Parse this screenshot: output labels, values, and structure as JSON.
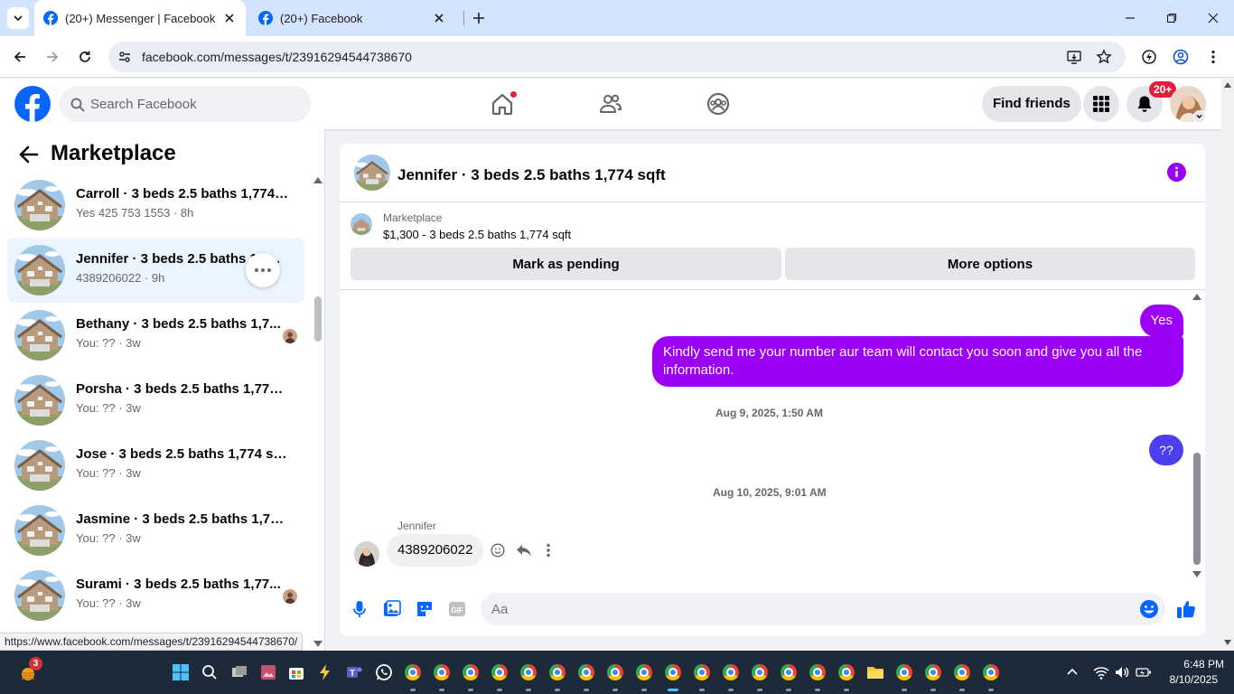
{
  "browser": {
    "tabs": [
      {
        "title": "(20+) Messenger | Facebook",
        "active": true
      },
      {
        "title": "(20+) Facebook",
        "active": false
      }
    ],
    "url": "facebook.com/messages/t/23916294544738670",
    "status_url": "https://www.facebook.com/messages/t/23916294544738670/"
  },
  "fb_header": {
    "search_placeholder": "Search Facebook",
    "find_friends": "Find friends",
    "notif_badge": "20+",
    "brand_color": "#0866ff"
  },
  "sidebar": {
    "title": "Marketplace",
    "conversations": [
      {
        "name": "Carroll · 3 beds 2.5 baths 1,774 s...",
        "sub": "Yes 425 753 1553 · 8h",
        "selected": false
      },
      {
        "name": "Jennifer · 3 beds 2.5 baths 1,7...",
        "sub": "4389206022 · 9h",
        "selected": true
      },
      {
        "name": "Bethany · 3 beds 2.5 baths 1,7...",
        "sub": "You: ?? · 3w",
        "selected": false
      },
      {
        "name": "Porsha · 3 beds 2.5 baths 1,774 s...",
        "sub": "You: ?? · 3w",
        "selected": false
      },
      {
        "name": "Jose · 3 beds 2.5 baths 1,774 sqft",
        "sub": "You: ?? · 3w",
        "selected": false
      },
      {
        "name": "Jasmine · 3 beds 2.5 baths 1,774 ...",
        "sub": "You: ?? · 3w",
        "selected": false
      },
      {
        "name": "Surami · 3 beds 2.5 baths 1,77...",
        "sub": "You: ?? · 3w",
        "selected": false
      }
    ]
  },
  "chat": {
    "title": "Jennifer · 3 beds 2.5 baths 1,774 sqft",
    "listing_label": "Marketplace",
    "listing_desc": "$1,300 - 3 beds 2.5 baths 1,774 sqft",
    "mark_pending": "Mark as pending",
    "more_options": "More options",
    "messages": {
      "out1": "Yes",
      "out2": "Kindly send me your number aur team will contact you soon and give you all the information.",
      "time1": "Aug 9, 2025, 1:50 AM",
      "out3": "??",
      "time2": "Aug 10, 2025, 9:01 AM",
      "sender": "Jennifer",
      "in1": "4389206022"
    },
    "composer_placeholder": "Aa",
    "accent_color": "#9b00f5"
  },
  "taskbar": {
    "weather_badge": "3",
    "time": "6:48 PM",
    "date": "8/10/2025"
  }
}
